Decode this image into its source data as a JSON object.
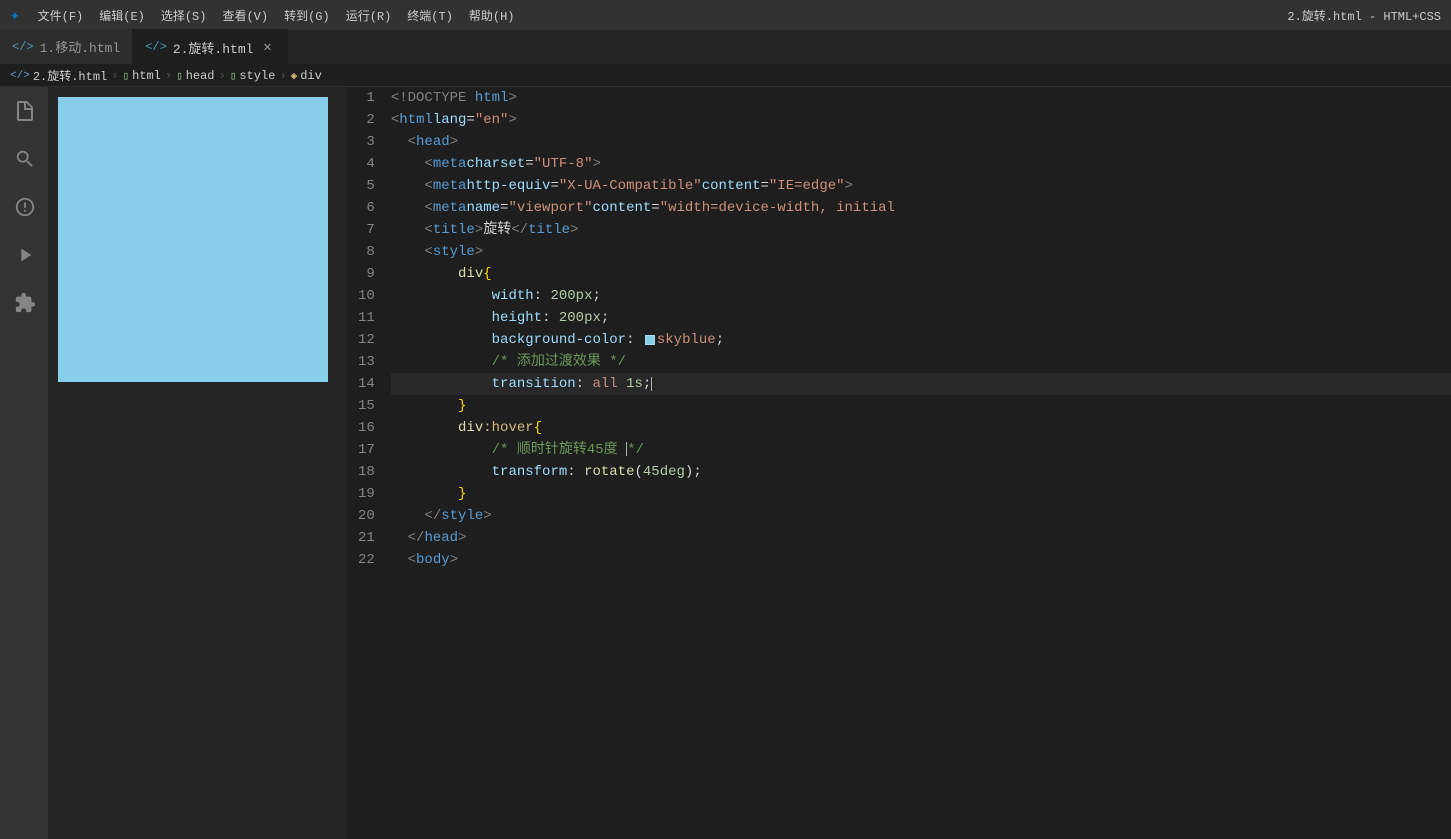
{
  "titlebar": {
    "logo": "✦",
    "menus": [
      "文件(F)",
      "编辑(E)",
      "选择(S)",
      "查看(V)",
      "转到(G)",
      "运行(R)",
      "终端(T)",
      "帮助(H)"
    ],
    "right_title": "2.旋转.html - HTML+CSS"
  },
  "tabs": [
    {
      "id": "tab1",
      "icon": "</>",
      "label": "1.移动.html",
      "active": false,
      "closeable": false
    },
    {
      "id": "tab2",
      "icon": "</>",
      "label": "2.旋转.html",
      "active": true,
      "closeable": true
    }
  ],
  "breadcrumb": [
    {
      "icon": "</>",
      "label": "2.旋转.html"
    },
    {
      "icon": "◫",
      "label": "html"
    },
    {
      "icon": "◫",
      "label": "head"
    },
    {
      "icon": "◫",
      "label": "style"
    },
    {
      "icon": "◈",
      "label": "div"
    }
  ],
  "activity_items": [
    {
      "id": "files",
      "icon": "⧉",
      "active": false
    },
    {
      "id": "search",
      "icon": "🔍",
      "active": false
    },
    {
      "id": "git",
      "icon": "⑂",
      "active": false
    },
    {
      "id": "run",
      "icon": "▶",
      "active": false
    },
    {
      "id": "extensions",
      "icon": "⊞",
      "active": false
    }
  ],
  "code_lines": [
    {
      "num": 1,
      "content": "<!DOCTYPE html>"
    },
    {
      "num": 2,
      "content": "<html lang=\"en\">"
    },
    {
      "num": 3,
      "content": "  <head>"
    },
    {
      "num": 4,
      "content": "    <meta charset=\"UTF-8\">"
    },
    {
      "num": 5,
      "content": "    <meta http-equiv=\"X-UA-Compatible\" content=\"IE=edge\">"
    },
    {
      "num": 6,
      "content": "    <meta name=\"viewport\" content=\"width=device-width, initial"
    },
    {
      "num": 7,
      "content": "    <title>旋转</title>"
    },
    {
      "num": 8,
      "content": "    <style>"
    },
    {
      "num": 9,
      "content": "      div {"
    },
    {
      "num": 10,
      "content": "        width: 200px;"
    },
    {
      "num": 11,
      "content": "        height: 200px;"
    },
    {
      "num": 12,
      "content": "        background-color: skyblue;"
    },
    {
      "num": 13,
      "content": "        /* 添加过渡效果 */"
    },
    {
      "num": 14,
      "content": "        transition: all 1s;",
      "active": true
    },
    {
      "num": 15,
      "content": "      }"
    },
    {
      "num": 16,
      "content": "      div:hover {"
    },
    {
      "num": 17,
      "content": "        /* 顺时针旋转45度 */"
    },
    {
      "num": 18,
      "content": "        transform: rotate(45deg);"
    },
    {
      "num": 19,
      "content": "      }"
    },
    {
      "num": 20,
      "content": "    </style>"
    },
    {
      "num": 21,
      "content": "  </head>"
    },
    {
      "num": 22,
      "content": "  <body>"
    }
  ]
}
